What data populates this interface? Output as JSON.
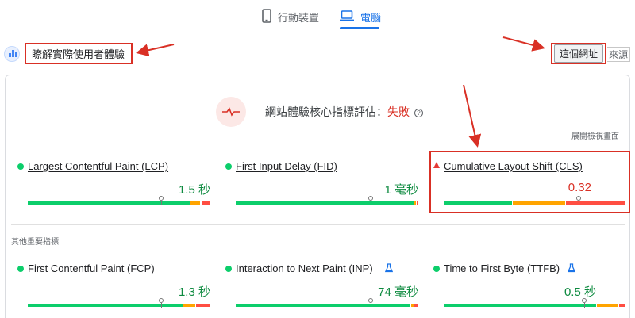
{
  "tabs": [
    {
      "label": "行動裝置",
      "icon": "phone-icon",
      "active": false
    },
    {
      "label": "電腦",
      "icon": "laptop-icon",
      "active": true
    }
  ],
  "field_section": {
    "title": "瞭解實際使用者體驗",
    "icon": "crux-bar-chart-icon",
    "url_button": "這個網址",
    "origin_button": "來源"
  },
  "assessment": {
    "label": "網站體驗核心指標評估：",
    "result": "失敗",
    "icon": "failed-pulse-icon",
    "expand_label": "展開檢視畫面"
  },
  "core_metrics": [
    {
      "name": "Largest Contentful Paint (LCP)",
      "value": "1.5 秒",
      "status": "good",
      "distribution": {
        "good": 0.89,
        "needs_improvement": 0.06,
        "poor": 0.05
      },
      "marker": 0.73
    },
    {
      "name": "First Input Delay (FID)",
      "value": "1 毫秒",
      "status": "good",
      "distribution": {
        "good": 0.98,
        "needs_improvement": 0.01,
        "poor": 0.01
      },
      "marker": 0.74
    },
    {
      "name": "Cumulative Layout Shift (CLS)",
      "value": "0.32",
      "status": "poor",
      "distribution": {
        "good": 0.38,
        "needs_improvement": 0.29,
        "poor": 0.33
      },
      "marker": 0.74
    }
  ],
  "other_section_label": "其他重要指標",
  "other_metrics": [
    {
      "name": "First Contentful Paint (FCP)",
      "value": "1.3 秒",
      "status": "good",
      "experimental": false,
      "distribution": {
        "good": 0.85,
        "needs_improvement": 0.07,
        "poor": 0.08
      },
      "marker": 0.73
    },
    {
      "name": "Interaction to Next Paint (INP)",
      "value": "74 毫秒",
      "status": "good",
      "experimental": true,
      "distribution": {
        "good": 0.96,
        "needs_improvement": 0.02,
        "poor": 0.02
      },
      "marker": 0.74
    },
    {
      "name": "Time to First Byte (TTFB)",
      "value": "0.5 秒",
      "status": "good",
      "experimental": true,
      "distribution": {
        "good": 0.84,
        "needs_improvement": 0.12,
        "poor": 0.04
      },
      "marker": 0.77
    }
  ],
  "colors": {
    "good": "#0cce6b",
    "needs_improvement": "#ffa400",
    "poor": "#ff4e42",
    "accent": "#1a73e8",
    "annotation": "#d93025"
  }
}
